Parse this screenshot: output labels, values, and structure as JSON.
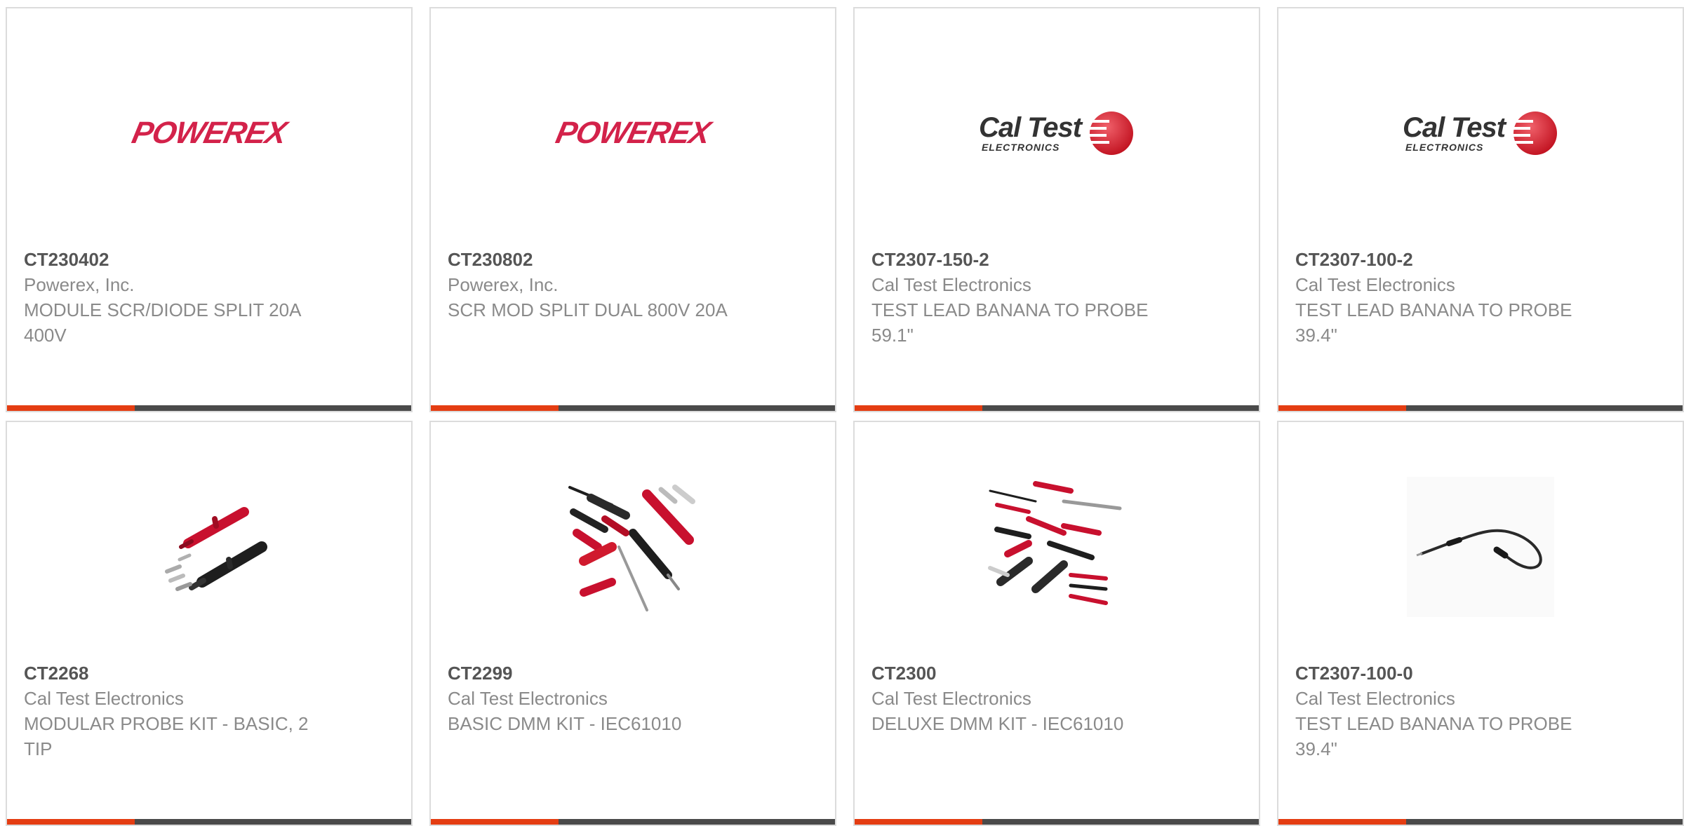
{
  "colors": {
    "accent": "#e43d12",
    "bar": "#4a4a4a",
    "border": "#dcdcdc",
    "powerex_red": "#d3224a",
    "caltest_red": "#d9202e"
  },
  "products": [
    {
      "part_number": "CT230402",
      "manufacturer": "Powerex, Inc.",
      "description": "MODULE SCR/DIODE SPLIT 20A 400V",
      "image_icon": "powerex-logo",
      "logo_text": "POWEREX"
    },
    {
      "part_number": "CT230802",
      "manufacturer": "Powerex, Inc.",
      "description": "SCR MOD SPLIT DUAL 800V 20A",
      "image_icon": "powerex-logo",
      "logo_text": "POWEREX"
    },
    {
      "part_number": "CT2307-150-2",
      "manufacturer": "Cal Test Electronics",
      "description": "TEST LEAD BANANA TO PROBE 59.1\"",
      "image_icon": "caltest-logo",
      "logo_text": "Cal Test",
      "logo_subtext": "ELECTRONICS"
    },
    {
      "part_number": "CT2307-100-2",
      "manufacturer": "Cal Test Electronics",
      "description": "TEST LEAD BANANA TO PROBE 39.4\"",
      "image_icon": "caltest-logo",
      "logo_text": "Cal Test",
      "logo_subtext": "ELECTRONICS"
    },
    {
      "part_number": "CT2268",
      "manufacturer": "Cal Test Electronics",
      "description": "MODULAR PROBE KIT - BASIC, 2 TIP",
      "image_icon": "probe-kit-photo"
    },
    {
      "part_number": "CT2299",
      "manufacturer": "Cal Test Electronics",
      "description": "BASIC DMM KIT - IEC61010",
      "image_icon": "dmm-kit-photo"
    },
    {
      "part_number": "CT2300",
      "manufacturer": "Cal Test Electronics",
      "description": "DELUXE DMM KIT - IEC61010",
      "image_icon": "deluxe-dmm-kit-photo"
    },
    {
      "part_number": "CT2307-100-0",
      "manufacturer": "Cal Test Electronics",
      "description": "TEST LEAD BANANA TO PROBE 39.4\"",
      "image_icon": "test-lead-photo"
    }
  ]
}
